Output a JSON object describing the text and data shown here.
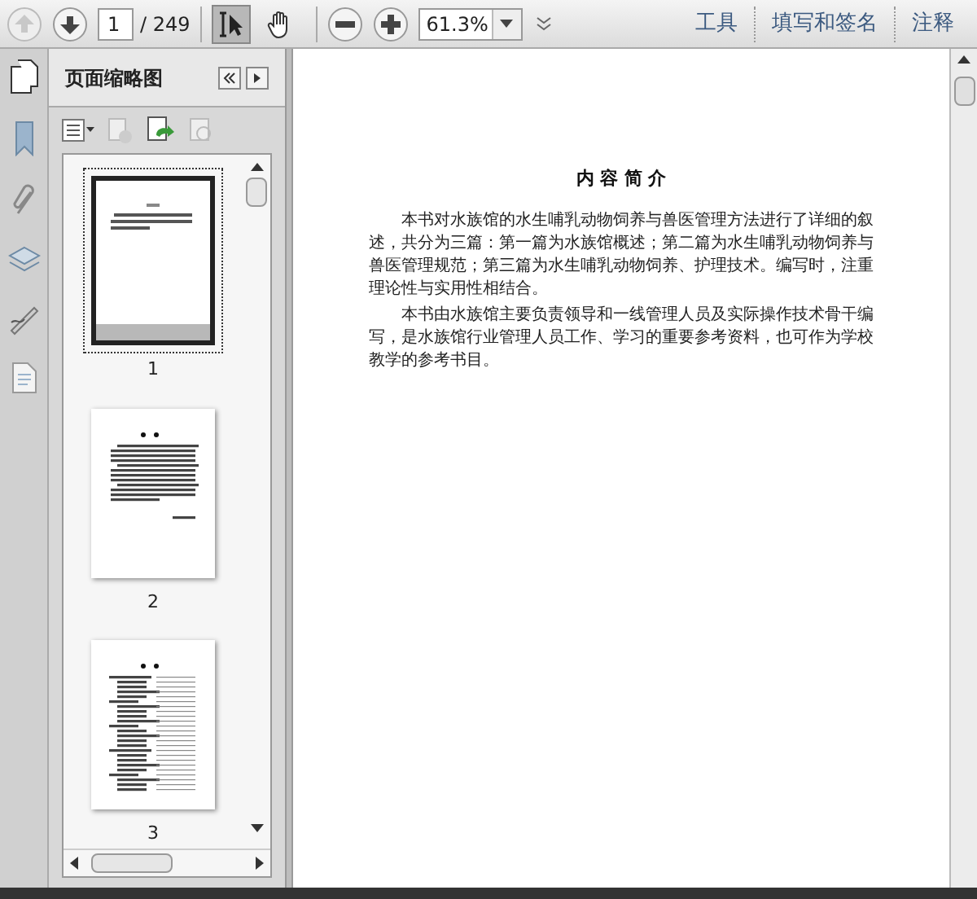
{
  "toolbar": {
    "page_input": "1",
    "page_total": "/ 249",
    "zoom": "61.3%",
    "tools": [
      {
        "kind": "select",
        "selected": true
      },
      {
        "kind": "hand",
        "selected": false
      }
    ],
    "links": [
      "工具",
      "填写和签名",
      "注释"
    ]
  },
  "panel": {
    "title": "页面缩略图",
    "thumbnails": [
      {
        "kind": "intro",
        "label": "1",
        "selected": true
      },
      {
        "kind": "preface",
        "label": "2",
        "selected": false
      },
      {
        "kind": "contents",
        "label": "3",
        "selected": false
      }
    ]
  },
  "document": {
    "heading": "内 容 简 介",
    "paragraphs": [
      "本书对水族馆的水生哺乳动物饲养与兽医管理方法进行了详细的叙述，共分为三篇：第一篇为水族馆概述；第二篇为水生哺乳动物饲养与兽医管理规范；第三篇为水生哺乳动物饲养、护理技术。编写时，注重理论性与实用性相结合。",
      "本书由水族馆主要负责领导和一线管理人员及实际操作技术骨干编写，是水族馆行业管理人员工作、学习的重要参考资料，也可作为学校教学的参考书目。"
    ]
  }
}
